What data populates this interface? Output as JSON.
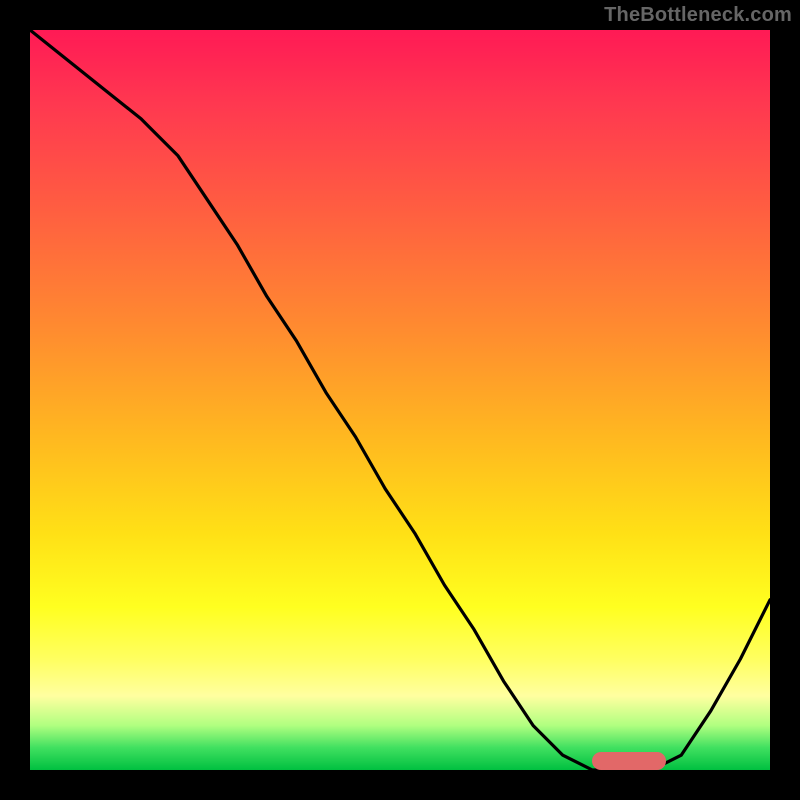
{
  "attribution": "TheBottleneck.com",
  "colors": {
    "gradient_top": "#ff1a55",
    "gradient_mid": "#ffe016",
    "gradient_bottom": "#00c040",
    "curve_stroke": "#000000",
    "marker_fill": "#e26868",
    "background": "#000000"
  },
  "chart_data": {
    "type": "line",
    "title": "",
    "xlabel": "",
    "ylabel": "",
    "xlim": [
      0,
      100
    ],
    "ylim": [
      0,
      100
    ],
    "series": [
      {
        "name": "bottleneck-curve",
        "x": [
          0,
          5,
          10,
          15,
          20,
          24,
          28,
          32,
          36,
          40,
          44,
          48,
          52,
          56,
          60,
          64,
          68,
          72,
          76,
          80,
          84,
          88,
          92,
          96,
          100
        ],
        "y": [
          100,
          96,
          92,
          88,
          83,
          77,
          71,
          64,
          58,
          51,
          45,
          38,
          32,
          25,
          19,
          12,
          6,
          2,
          0,
          0,
          0,
          2,
          8,
          15,
          23
        ]
      }
    ],
    "optimal_marker": {
      "x_start": 76,
      "x_end": 86,
      "y": 0,
      "label": "optimal-range"
    }
  }
}
